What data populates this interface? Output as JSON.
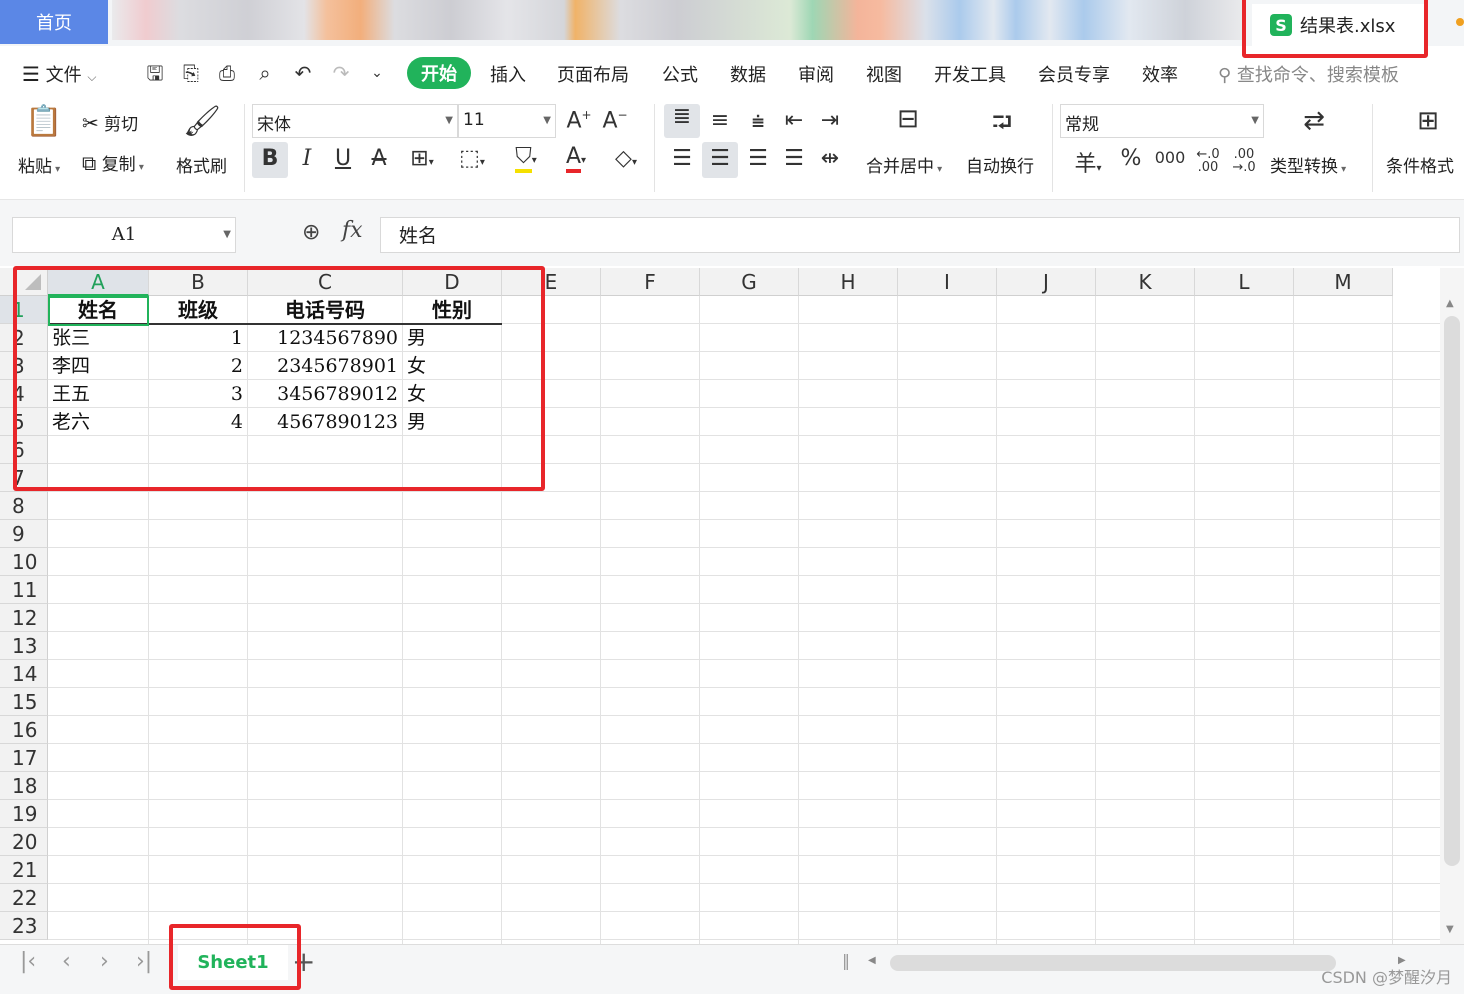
{
  "titlebar": {
    "home_tab": "首页",
    "file_tab": "结果表.xlsx"
  },
  "menu": {
    "file": "文件",
    "tabs": [
      "开始",
      "插入",
      "页面布局",
      "公式",
      "数据",
      "审阅",
      "视图",
      "开发工具",
      "会员专享",
      "效率"
    ],
    "search_placeholder": "查找命令、搜索模板"
  },
  "ribbon": {
    "paste": "粘贴",
    "cut": "剪切",
    "copy": "复制",
    "format_painter": "格式刷",
    "font_name": "宋体",
    "font_size": "11",
    "bold": "B",
    "italic": "I",
    "underline": "U",
    "merge_center": "合并居中",
    "wrap_text": "自动换行",
    "number_format": "常规",
    "currency": "羊",
    "percent": "%",
    "thousands": "000",
    "inc_decimal": "←.0 .00",
    "dec_decimal": ".00 →.0",
    "type_convert": "类型转换",
    "conditional_format": "条件格式"
  },
  "formula_bar": {
    "name_box": "A1",
    "fx": "fx",
    "value": "姓名"
  },
  "grid": {
    "columns": [
      "A",
      "B",
      "C",
      "D",
      "E",
      "F",
      "G",
      "H",
      "I",
      "J",
      "K",
      "L",
      "M"
    ],
    "rows": [
      "1",
      "2",
      "3",
      "4",
      "5",
      "6",
      "7",
      "8",
      "9",
      "10",
      "11",
      "12",
      "13",
      "14",
      "15",
      "16",
      "17",
      "18",
      "19",
      "20",
      "21",
      "22",
      "23"
    ],
    "headers": [
      "姓名",
      "班级",
      "电话号码",
      "性别"
    ],
    "data": [
      [
        "张三",
        "1",
        "1234567890",
        "男"
      ],
      [
        "李四",
        "2",
        "2345678901",
        "女"
      ],
      [
        "王五",
        "3",
        "3456789012",
        "女"
      ],
      [
        "老六",
        "4",
        "4567890123",
        "男"
      ]
    ]
  },
  "sheets": {
    "active": "Sheet1",
    "add": "+"
  },
  "watermark": "CSDN @梦醒汐月",
  "colors": {
    "accent": "#21b35b",
    "highlight": "#e8262a",
    "home_tab": "#5b87e6"
  }
}
